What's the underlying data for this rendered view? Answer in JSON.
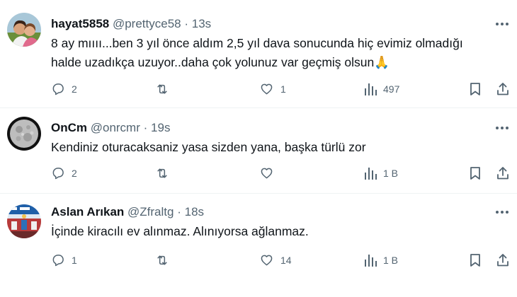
{
  "tweets": [
    {
      "name": "hayat5858",
      "handle": "@prettyce58",
      "separator": "·",
      "time": "13s",
      "text_lines": [
        "8 ay mıııı...ben 3 yıl önce aldım 2,5 yıl dava sonucunda hiç evimiz olmadığı",
        "halde uzadıkça uzuyor..daha çok yolunuz var geçmiş olsun🙏"
      ],
      "replies": "2",
      "retweets": "",
      "likes": "1",
      "views": "497"
    },
    {
      "name": "OnCm",
      "handle": "@onrcmr",
      "separator": "·",
      "time": "19s",
      "text_lines": [
        "Kendiniz oturacaksaniz yasa sizden yana, başka türlü zor"
      ],
      "replies": "2",
      "retweets": "",
      "likes": "",
      "views": "1 B"
    },
    {
      "name": "Aslan Arıkan",
      "handle": "@Zfraltg",
      "separator": "·",
      "time": "18s",
      "text_lines": [
        "İçinde kiracılı ev alınmaz. Alınıyorsa ağlanmaz."
      ],
      "replies": "1",
      "retweets": "",
      "likes": "14",
      "views": "1 B"
    }
  ],
  "icons": {
    "more": "more-dots-icon",
    "reply": "reply-bubble-icon",
    "retweet": "retweet-icon",
    "like": "heart-icon",
    "views": "analytics-bars-icon",
    "bookmark": "bookmark-icon",
    "share": "share-upload-icon"
  },
  "colors": {
    "text_primary": "#0f1419",
    "text_secondary": "#536471",
    "divider": "#eff3f4",
    "emoji_hands": "#f5b400"
  }
}
